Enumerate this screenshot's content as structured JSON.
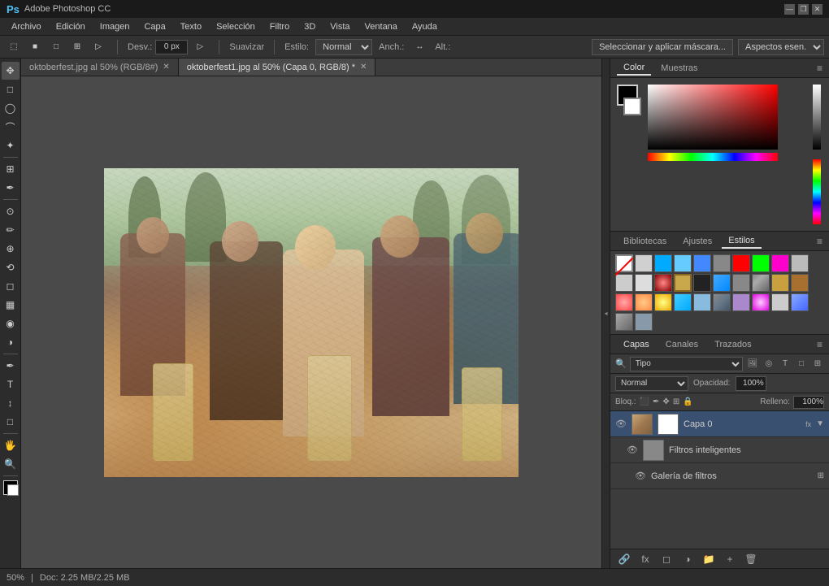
{
  "titlebar": {
    "app": "Ps",
    "minimize": "—",
    "maximize": "❐",
    "close": "✕"
  },
  "menubar": {
    "items": [
      "Archivo",
      "Edición",
      "Imagen",
      "Capa",
      "Texto",
      "Selección",
      "Filtro",
      "3D",
      "Vista",
      "Ventana",
      "Ayuda"
    ]
  },
  "optionsbar": {
    "desviation_label": "Desv.:",
    "desviation_value": "0 px",
    "suavizar_label": "Suavizar",
    "estilo_label": "Estilo:",
    "estilo_value": "Normal",
    "ancho_label": "Anch.:",
    "alto_label": "Alt.:",
    "mask_btn": "Seleccionar y aplicar máscara...",
    "essentials": "Aspectos esen."
  },
  "tabs": [
    {
      "label": "oktoberfest.jpg al 50% (RGB/8#)",
      "active": false
    },
    {
      "label": "oktoberfest1.jpg al 50% (Capa 0, RGB/8) *",
      "active": true
    }
  ],
  "toolbar": {
    "tools": [
      "⊹",
      "□",
      "⬚",
      "◯",
      "↖",
      "⊕",
      "✂",
      "⟲",
      "✥",
      "⌖",
      "✒",
      "∥",
      "⬡",
      "✍",
      "✏",
      "🔲",
      "◆",
      "⊘",
      "T",
      "↕",
      "🖐",
      "🔍",
      "▲",
      "▼"
    ]
  },
  "colorpanel": {
    "tabs": [
      "Color",
      "Muestras"
    ],
    "active_tab": "Color"
  },
  "stylespanel": {
    "tabs": [
      "Bibliotecas",
      "Ajustes",
      "Estilos"
    ],
    "active_tab": "Estilos"
  },
  "layerspanel": {
    "tabs": [
      "Capas",
      "Canales",
      "Trazados"
    ],
    "active_tab": "Capas",
    "blend_mode": "Normal",
    "opacity_label": "Opacidad:",
    "opacity_value": "100%",
    "lock_label": "Bloq.:",
    "fill_label": "Relleno:",
    "fill_value": "100%",
    "layers": [
      {
        "name": "Capa 0",
        "visible": true,
        "active": true,
        "type": "photo"
      },
      {
        "name": "Filtros inteligentes",
        "visible": true,
        "active": false,
        "type": "smart"
      },
      {
        "name": "Galería de filtros",
        "visible": true,
        "active": false,
        "type": "filter"
      }
    ],
    "filter_placeholder": "Tipo"
  },
  "statusbar": {
    "zoom": "50%",
    "doc": "Doc: 2.25 MB/2.25 MB"
  },
  "styles_swatches": [
    "#fff",
    "#e0e0e0",
    "#0af",
    "#08f",
    "#06f",
    "#888",
    "#f00",
    "#0f0",
    "#f0f",
    "#ff0",
    "#000",
    "#0ff",
    "#f00",
    "#ddd",
    "#ccc",
    "#bbb",
    "#f80",
    "#c82",
    "#f44",
    "#f84",
    "#888",
    "#fa0",
    "#ea0",
    "#8cf",
    "#8bf",
    "#a8a",
    "#d8d",
    "#ccc",
    "#789",
    "#567",
    "#678",
    "#8cf",
    "#8af",
    "#888"
  ]
}
